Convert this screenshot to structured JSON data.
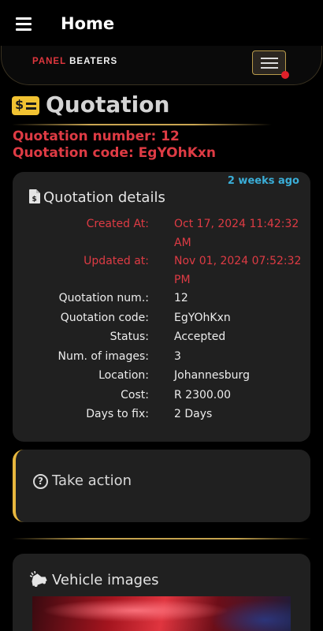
{
  "appbar": {
    "title": "Home"
  },
  "brand": {
    "part1": "PANEL",
    "part2": "BEATERS"
  },
  "heading": {
    "title": "Quotation"
  },
  "summary": {
    "number": "Quotation number: 12",
    "code": "Quotation code: EgYOhKxn"
  },
  "details": {
    "title": "Quotation details",
    "relative_time": "2 weeks ago",
    "rows": [
      {
        "label": "Created At:",
        "value": "Oct 17, 2024 11:42:32 AM"
      },
      {
        "label": "Updated at:",
        "value": "Nov 01, 2024 07:52:32 PM"
      },
      {
        "label": "Quotation num.:",
        "value": "12"
      },
      {
        "label": "Quotation code:",
        "value": "EgYOhKxn"
      },
      {
        "label": "Status:",
        "value": "Accepted"
      },
      {
        "label": "Num. of images:",
        "value": "3"
      },
      {
        "label": "Location:",
        "value": "Johannesburg"
      },
      {
        "label": "Cost:",
        "value": "R 2300.00"
      },
      {
        "label": "Days to fix:",
        "value": "2 Days"
      }
    ]
  },
  "action": {
    "title": "Take action"
  },
  "images": {
    "title": "Vehicle images"
  },
  "colors": {
    "accent_red": "#de3b44",
    "accent_gold": "#e8b73e",
    "link_blue": "#3aaed8",
    "card_bg": "#202020"
  },
  "icons": [
    "menu-icon",
    "navbar-toggler-icon",
    "money-bill-icon",
    "file-invoice-dollar-icon",
    "question-circle-icon",
    "car-crash-icon"
  ]
}
